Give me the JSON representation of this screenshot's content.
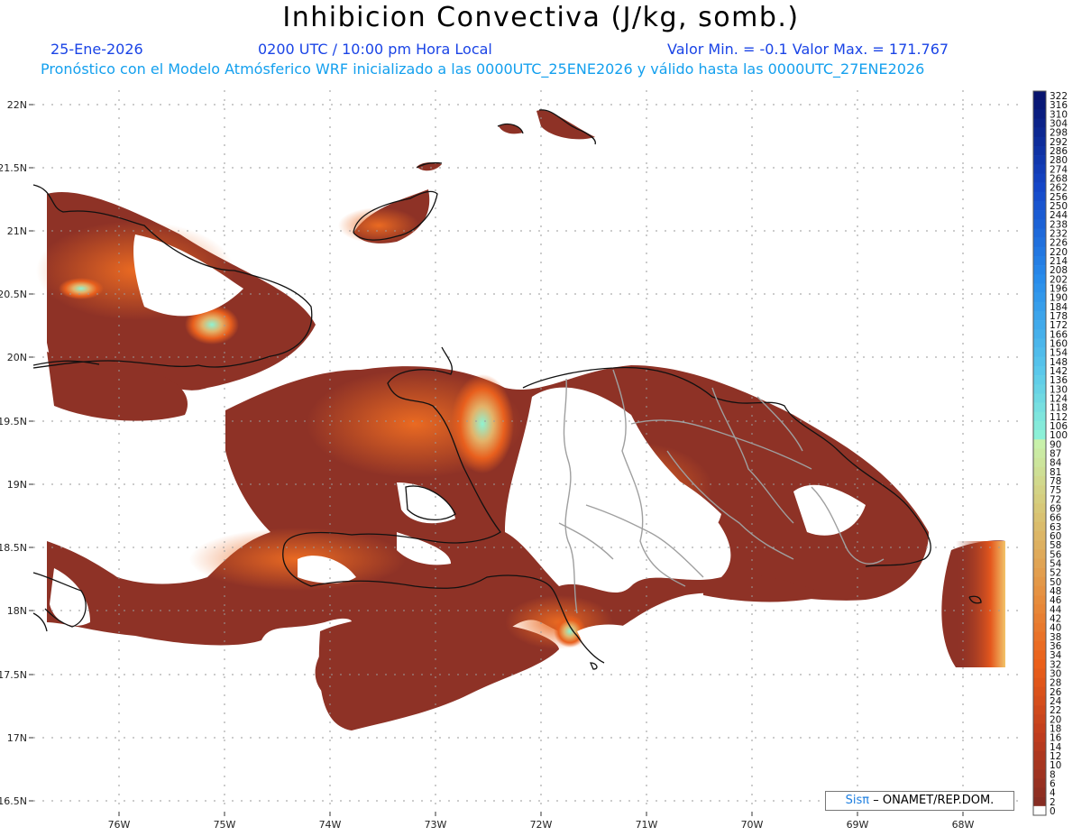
{
  "header": {
    "title": "Inhibicion Convectiva (J/kg, somb.)",
    "date": "25-Ene-2026",
    "time": "0200 UTC / 10:00 pm Hora Local",
    "range": "Valor Min. = -0.1  Valor Max. = 171.767",
    "model_info": "Pronóstico con el Modelo Atmósferico WRF inicializado a las 0000UTC_25ENE2026 y válido hasta las  0000UTC_27ENE2026"
  },
  "axes": {
    "lat_labels": [
      "22N",
      "21.5N",
      "21N",
      "20.5N",
      "20N",
      "19.5N",
      "19N",
      "18.5N",
      "18N",
      "17.5N",
      "17N",
      "16.5N"
    ],
    "lon_labels": [
      "76W",
      "75W",
      "74W",
      "73W",
      "72W",
      "71W",
      "70W",
      "69W",
      "68W"
    ]
  },
  "colorbar": {
    "labels": [
      "322",
      "316",
      "310",
      "304",
      "298",
      "292",
      "286",
      "280",
      "274",
      "268",
      "262",
      "256",
      "250",
      "244",
      "238",
      "232",
      "226",
      "220",
      "214",
      "208",
      "202",
      "196",
      "190",
      "184",
      "178",
      "172",
      "166",
      "160",
      "154",
      "148",
      "142",
      "136",
      "130",
      "124",
      "118",
      "112",
      "106",
      "100",
      "90",
      "87",
      "84",
      "81",
      "78",
      "75",
      "72",
      "69",
      "66",
      "63",
      "60",
      "58",
      "56",
      "54",
      "52",
      "50",
      "48",
      "46",
      "44",
      "42",
      "40",
      "38",
      "36",
      "34",
      "32",
      "30",
      "28",
      "26",
      "24",
      "22",
      "20",
      "18",
      "16",
      "14",
      "12",
      "10",
      "8",
      "6",
      "4",
      "2",
      "0"
    ]
  },
  "credit": {
    "sis": "Sisπ",
    "text": "– ONAMET/REP.DOM."
  },
  "colors": {
    "low": "#8e3226",
    "mid": "#e4571d",
    "high": "#8ef3d2",
    "blue_top": "#0a1670",
    "border": "#9a9a9a"
  }
}
